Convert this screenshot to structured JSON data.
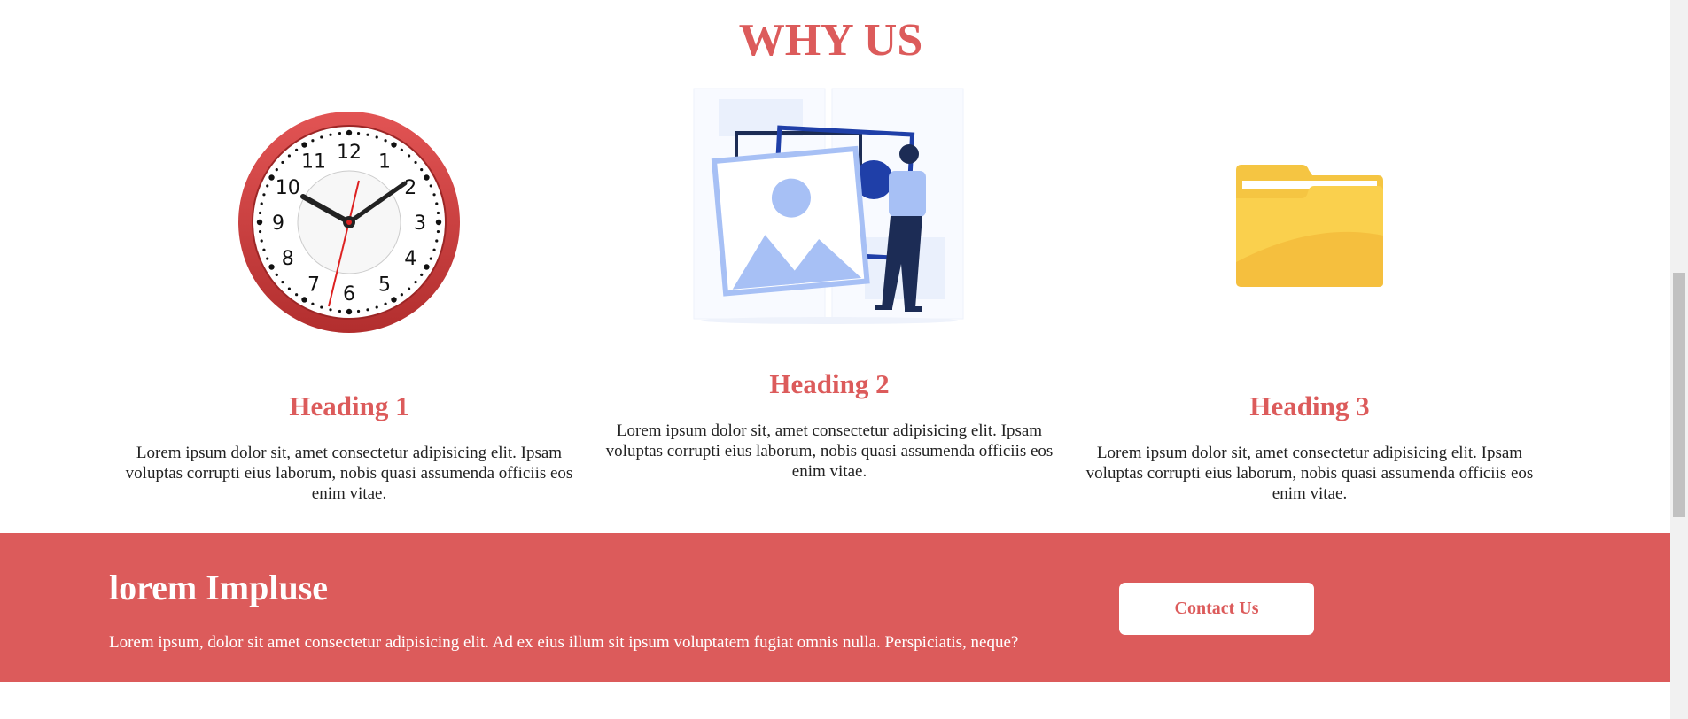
{
  "section": {
    "title": "WHY US"
  },
  "features": [
    {
      "icon": "clock-icon",
      "heading": "Heading 1",
      "text": "Lorem ipsum dolor sit, amet consectetur adipisicing elit. Ipsam voluptas corrupti eius laborum, nobis quasi assumenda officiis eos enim vitae."
    },
    {
      "icon": "photo-gallery-illustration",
      "heading": "Heading 2",
      "text": "Lorem ipsum dolor sit, amet consectetur adipisicing elit. Ipsam voluptas corrupti eius laborum, nobis quasi assumenda officiis eos enim vitae."
    },
    {
      "icon": "folder-icon",
      "heading": "Heading 3",
      "text": "Lorem ipsum dolor sit, amet consectetur adipisicing elit. Ipsam voluptas corrupti eius laborum, nobis quasi assumenda officiis eos enim vitae."
    }
  ],
  "cta": {
    "title": "lorem Impluse",
    "text": "Lorem ipsum, dolor sit amet consectetur adipisicing elit. Ad ex eius illum sit ipsum voluptatem fugiat omnis nulla. Perspiciatis, neque?",
    "button_label": "Contact Us"
  },
  "clock_numerals": [
    "12",
    "1",
    "2",
    "3",
    "4",
    "5",
    "6",
    "7",
    "8",
    "9",
    "10",
    "11"
  ],
  "colors": {
    "accent": "#dc5b5b",
    "folder": "#f8c94a",
    "illustration_blue": "#a7c0f5",
    "illustration_dark": "#1f3fa8"
  }
}
